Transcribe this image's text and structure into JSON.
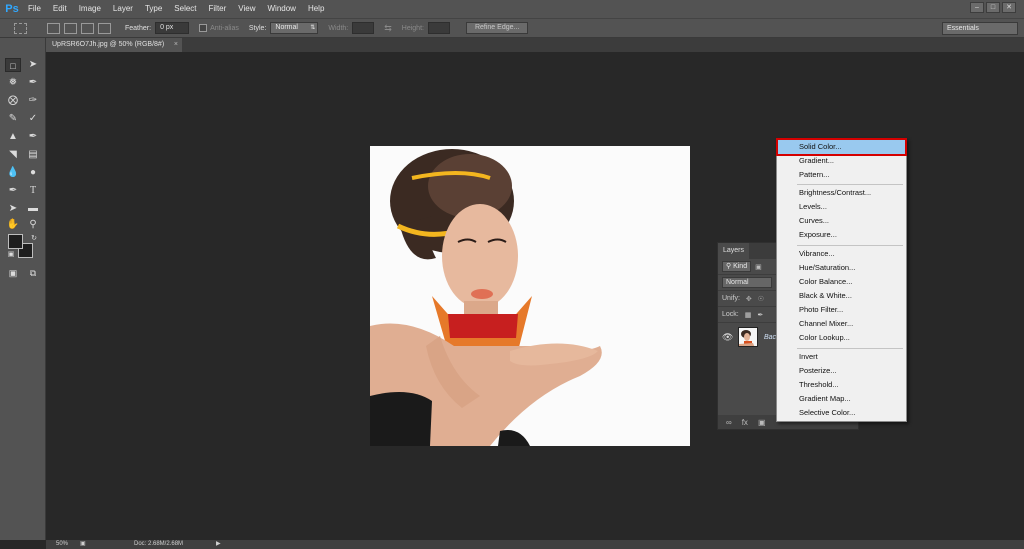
{
  "app": {
    "logo": "Ps"
  },
  "menubar": {
    "items": [
      "File",
      "Edit",
      "Image",
      "Layer",
      "Type",
      "Select",
      "Filter",
      "View",
      "Window",
      "Help"
    ],
    "window_controls": [
      "–",
      "□",
      "✕"
    ]
  },
  "options": {
    "feather_label": "Feather:",
    "feather_value": "0 px",
    "antialias_label": "Anti-alias",
    "style_label": "Style:",
    "style_value": "Normal",
    "width_label": "Width:",
    "height_label": "Height:",
    "refine_edge": "Refine Edge...",
    "workspace": "Essentials"
  },
  "document": {
    "tab_title": "UpRSR6O7Jh.jpg @ 50% (RGB/8#)",
    "tab_close": "×"
  },
  "status": {
    "zoom": "50%",
    "doc_info": "Doc: 2.68M/2.68M"
  },
  "layers_panel": {
    "tab": "Layers",
    "kind_label": "Kind",
    "blend_mode": "Normal",
    "unify_label": "Unify:",
    "lock_label": "Lock:",
    "layer_name": "Bac",
    "footer_icons": [
      "∞",
      "fx",
      "▣"
    ]
  },
  "adjustment_menu": {
    "groups": [
      [
        "Solid Color...",
        "Gradient...",
        "Pattern..."
      ],
      [
        "Brightness/Contrast...",
        "Levels...",
        "Curves...",
        "Exposure..."
      ],
      [
        "Vibrance...",
        "Hue/Saturation...",
        "Color Balance...",
        "Black & White...",
        "Photo Filter...",
        "Channel Mixer...",
        "Color Lookup..."
      ],
      [
        "Invert",
        "Posterize...",
        "Threshold...",
        "Gradient Map...",
        "Selective Color..."
      ]
    ],
    "highlighted": "Solid Color..."
  },
  "colors": {
    "ui_dark": "#282828",
    "ui_panel": "#535353",
    "menu_highlight": "#99c9ef",
    "highlight_outline": "#d40000",
    "ps_blue": "#31a8ff"
  }
}
